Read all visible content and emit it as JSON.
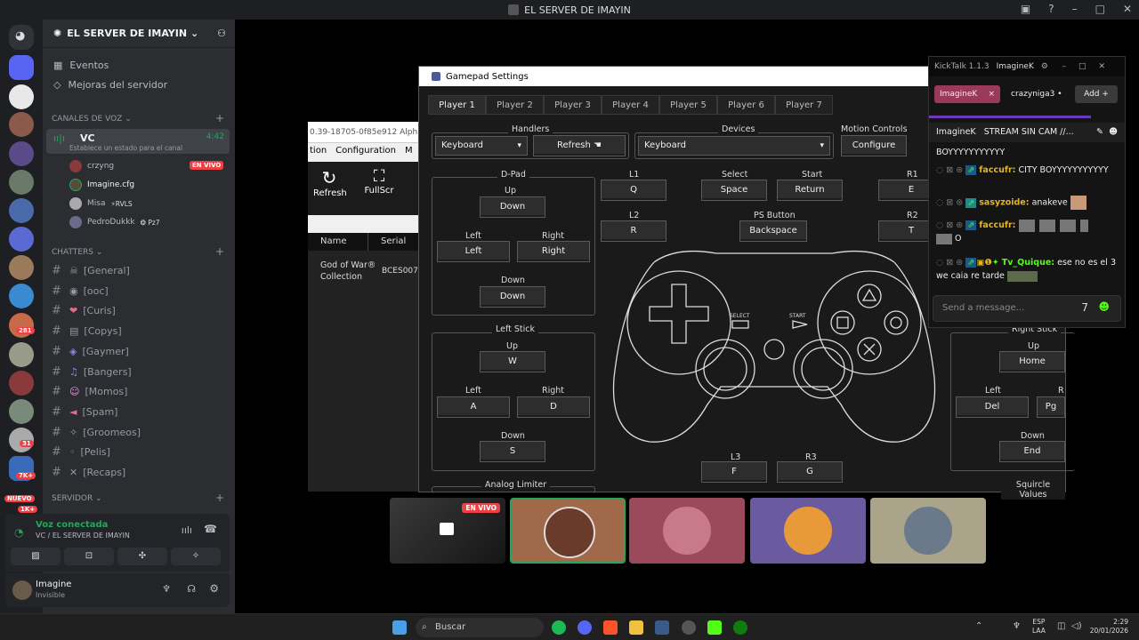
{
  "window": {
    "title": "EL SERVER DE IMAYIN"
  },
  "server": {
    "name": "EL SERVER DE IMAYIN",
    "nav": [
      {
        "label": "Eventos"
      },
      {
        "label": "Mejoras del servidor"
      }
    ],
    "badges": [
      "281",
      "31",
      "7K+",
      "1K+"
    ],
    "nuevo_label": "NUEVO",
    "voice_category": "Canales de voz",
    "voice_channel": {
      "name": "VC",
      "timer": "4:42",
      "status_prompt": "Establece un estado para el canal"
    },
    "voice_users": [
      {
        "name": "crzyng",
        "tag": "EN VIVO"
      },
      {
        "name": "Imagine.cfg",
        "tag": ""
      },
      {
        "name": "Misa",
        "tag": "RVLS"
      },
      {
        "name": "PedroDukkk",
        "tag": "Pz7"
      }
    ],
    "chatters_category": "CHATTERS",
    "text_channels": [
      "[General]",
      "[ooc]",
      "[Curis]",
      "[Copys]",
      "[Gaymer]",
      "[Bangers]",
      "[Momos]",
      "[Spam]",
      "[Groomeos]",
      "[Pelis]",
      "[Recaps]"
    ],
    "servidor_category": "SERVIDOR"
  },
  "voice_panel": {
    "status": "Voz conectada",
    "channel": "VC / EL SERVER DE IMAYIN"
  },
  "user_panel": {
    "name": "Imagine",
    "status": "Invisible"
  },
  "rpcs3": {
    "title_fragment": "0.39-18705-0f85e912 Alph",
    "menu": [
      "tion",
      "Configuration",
      "M"
    ],
    "toolbar": [
      {
        "label": "Refresh"
      },
      {
        "label": "FullScr"
      }
    ],
    "columns": [
      "Name",
      "Serial"
    ],
    "game": {
      "name": "God of War® Collection",
      "serial": "BCES007"
    }
  },
  "gamepad": {
    "title": "Gamepad Settings",
    "tabs": [
      "Player 1",
      "Player 2",
      "Player 3",
      "Player 4",
      "Player 5",
      "Player 6",
      "Player 7"
    ],
    "handlers_label": "Handlers",
    "handler_value": "Keyboard",
    "refresh_label": "Refresh",
    "devices_label": "Devices",
    "device_value": "Keyboard",
    "motion_label": "Motion Controls",
    "configure_label": "Configure",
    "dpad": {
      "title": "D-Pad",
      "up_label": "Up",
      "up": "Up",
      "left_label": "Left",
      "left": "Left",
      "right_label": "Right",
      "right": "Right",
      "down_label": "Down",
      "down": "Down"
    },
    "left_stick": {
      "title": "Left Stick",
      "up_label": "Up",
      "up": "W",
      "left_label": "Left",
      "left": "A",
      "right_label": "Right",
      "right": "D",
      "down_label": "Down",
      "down": "S"
    },
    "analog_limiter": "Analog Limiter",
    "l1": {
      "label": "L1",
      "value": "Q"
    },
    "l2": {
      "label": "L2",
      "value": "R"
    },
    "select": {
      "label": "Select",
      "value": "Space"
    },
    "start": {
      "label": "Start",
      "value": "Return"
    },
    "ps": {
      "label": "PS Button",
      "value": "Backspace"
    },
    "r1": {
      "label": "R1",
      "value": "E"
    },
    "r2": {
      "label": "R2",
      "value": "T"
    },
    "l3": {
      "label": "L3",
      "value": "F"
    },
    "r3": {
      "label": "R3",
      "value": "G"
    },
    "pad_select": "SELECT",
    "pad_start": "START",
    "right_stick": {
      "title": "Right Stick",
      "up_label": "Up",
      "up": "Home",
      "left_label": "Left",
      "left": "Del",
      "right_label": "R",
      "right": "Pg",
      "down_label": "Down",
      "down": "End"
    },
    "squircle": "Squircle Values"
  },
  "kicktalk": {
    "app": "KickTalk 1.1.3",
    "window_tab": "ImagineK",
    "tabs": [
      {
        "label": "ImagineK"
      },
      {
        "label": "crazyniga3"
      }
    ],
    "add_label": "Add",
    "stream_user": "ImagineK",
    "stream_title": "STREAM SIN CAM //...",
    "messages": [
      {
        "user": "",
        "text": "BOYYYYYYYYYYY"
      },
      {
        "user": "faccufr:",
        "text": "CITY BOYYYYYYYYYYY"
      },
      {
        "user": "sasyzoide:",
        "text": "anakeve"
      },
      {
        "user": "faccufr:",
        "text": "O"
      },
      {
        "user": "Tv_Quique:",
        "text": "ese no es el 3 we caia re tarde"
      }
    ],
    "input_placeholder": "Send a message..."
  },
  "tiles": {
    "live_label": "EN VIVO"
  },
  "taskbar": {
    "search_placeholder": "Buscar",
    "lang": "ESP",
    "region": "LAA",
    "time": "2:29",
    "date": "20/01/2026"
  },
  "colors": {
    "accent_green": "#23a55a",
    "live_red": "#ed4245",
    "kick_green": "#53fc18",
    "kick_pink": "#9a3a5a"
  }
}
